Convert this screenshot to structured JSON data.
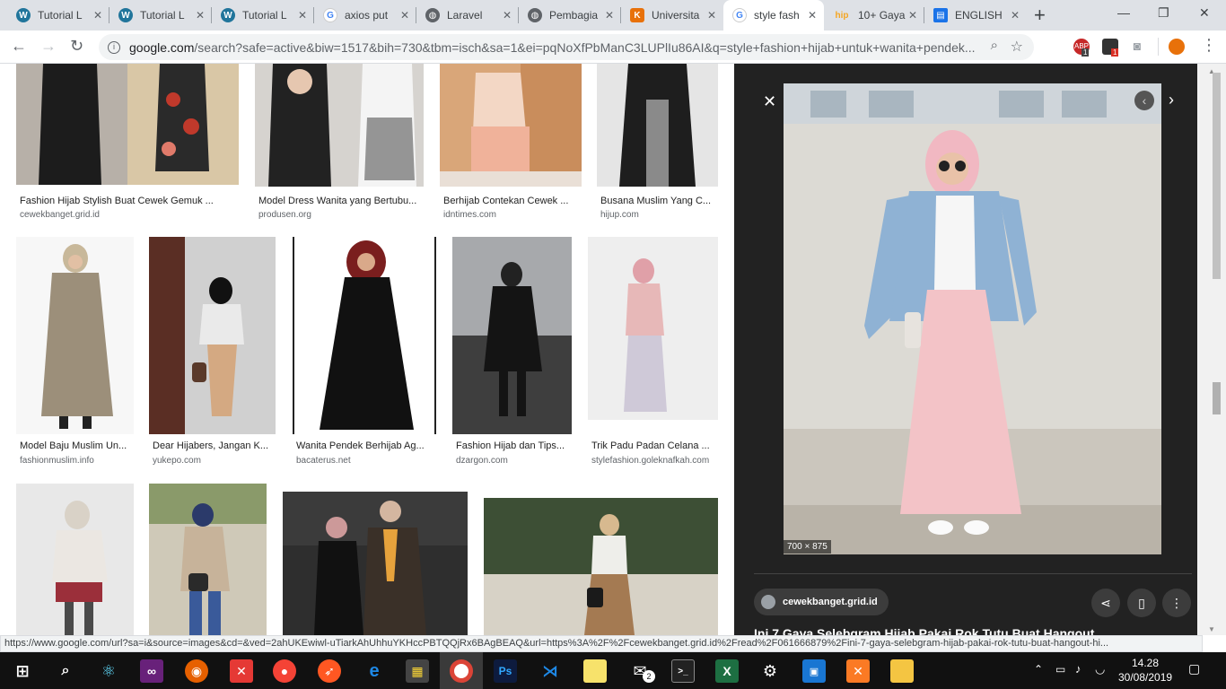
{
  "tabs": [
    {
      "label": "Tutorial L",
      "icon": "wordpress-icon",
      "color": "#21759b"
    },
    {
      "label": "Tutorial L",
      "icon": "wordpress-icon",
      "color": "#21759b"
    },
    {
      "label": "Tutorial L",
      "icon": "wordpress-icon",
      "color": "#21759b"
    },
    {
      "label": "axios put",
      "icon": "google-icon",
      "color": "#4285f4"
    },
    {
      "label": "Laravel",
      "icon": "globe-icon",
      "color": "#5f6368"
    },
    {
      "label": "Pembagia",
      "icon": "globe-icon",
      "color": "#5f6368"
    },
    {
      "label": "Universita",
      "icon": "university-logo-icon",
      "color": "#e8710a"
    },
    {
      "label": "style fash",
      "icon": "google-icon",
      "color": "#4285f4"
    },
    {
      "label": "10+ Gaya",
      "icon": "hip-icon",
      "color": "#f5a623"
    },
    {
      "label": "ENGLISH",
      "icon": "document-icon",
      "color": "#1a73e8"
    }
  ],
  "toolbar": {
    "url_host": "google.com",
    "url_path": "/search?safe=active&biw=1517&bih=730&tbm=isch&sa=1&ei=pqNoXfPbManC3LUPlIu86AI&q=style+fashion+hijab+untuk+wanita+pendek...",
    "ext_badges": [
      "1",
      "1"
    ]
  },
  "results": [
    {
      "title": "Fashion Hijab Stylish Buat Cewek Gemuk ...",
      "source": "cewekbanget.grid.id"
    },
    {
      "title": "Model Dress Wanita yang Bertubu...",
      "source": "produsen.org"
    },
    {
      "title": "Berhijab Contekan Cewek ...",
      "source": "idntimes.com"
    },
    {
      "title": "Busana Muslim Yang C...",
      "source": "hijup.com"
    },
    {
      "title": "Model Baju Muslim Un...",
      "source": "fashionmuslim.info"
    },
    {
      "title": "Dear Hijabers, Jangan K...",
      "source": "yukepo.com"
    },
    {
      "title": "Wanita Pendek Berhijab Ag...",
      "source": "bacaterus.net"
    },
    {
      "title": "Fashion Hijab dan Tips...",
      "source": "dzargon.com"
    },
    {
      "title": "Trik Padu Padan Celana ...",
      "source": "stylefashion.goleknafkah.com"
    }
  ],
  "panel": {
    "dimensions": "700 × 875",
    "source": "cewekbanget.grid.id",
    "title": "Ini 7 Gaya Selebgram Hijab Pakai Rok Tutu Buat Hangout"
  },
  "statusbar": {
    "url": "https://www.google.com/url?sa=i&source=images&cd=&ved=2ahUKEwiwl-uTiarkAhUhhuYKHccPBTQQjRx6BAgBEAQ&url=https%3A%2F%2Fcewekbanget.grid.id%2Fread%2F061666879%2Fini-7-gaya-selebgram-hijab-pakai-rok-tutu-buat-hangout-hi..."
  },
  "taskbar": {
    "time": "14.28",
    "date": "30/08/2019",
    "badge": "2"
  }
}
